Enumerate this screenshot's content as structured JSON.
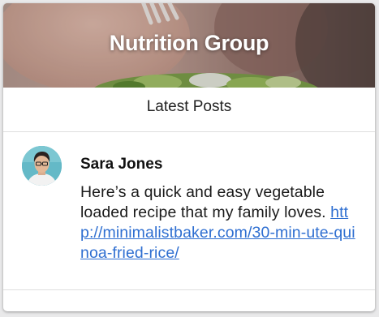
{
  "group": {
    "title": "Nutrition Group"
  },
  "tabs": {
    "active_label": "Latest Posts"
  },
  "post": {
    "author": "Sara Jones",
    "text": "Here’s a quick and easy vegetable loaded recipe that my family loves.",
    "link_text": "http://minimalistbaker.com/30-min-ute-quinoa-fried-rice/"
  },
  "colors": {
    "link": "#2f6fd1",
    "card_background": "#ffffff",
    "page_background": "#e9e9ea"
  }
}
